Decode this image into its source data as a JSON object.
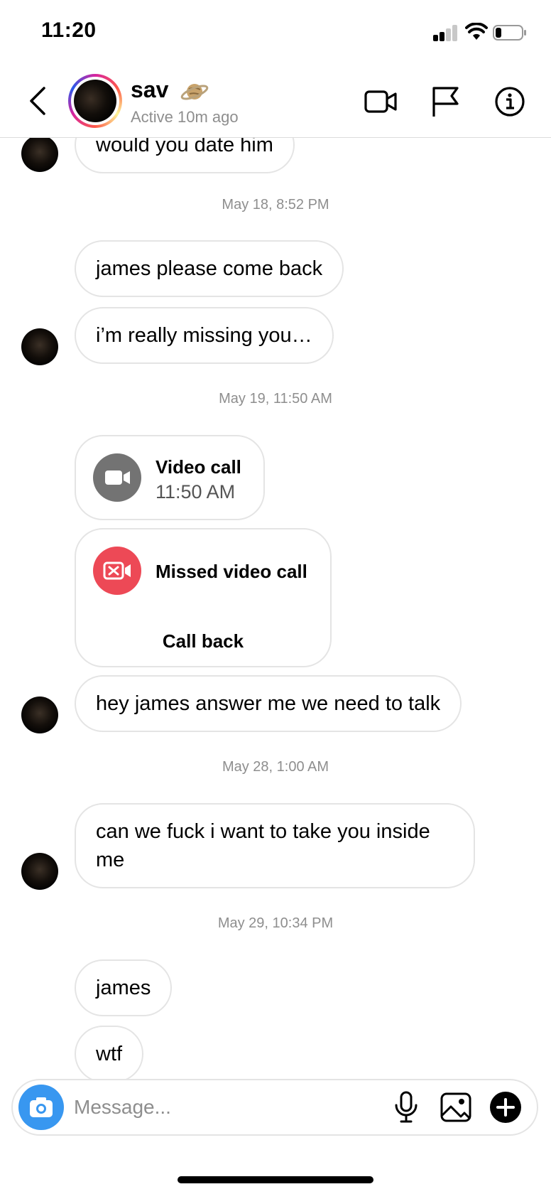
{
  "status_bar": {
    "time": "11:20",
    "signal_bars": 2,
    "battery_level": 0.2
  },
  "header": {
    "contact_name": "sav",
    "name_emoji": "planet",
    "active_status": "Active 10m ago",
    "icons": [
      "back-chevron",
      "video-camera",
      "flag",
      "info"
    ]
  },
  "thread": {
    "messages": [
      {
        "type": "text",
        "text": "would you date him"
      },
      {
        "type": "timestamp",
        "text": "May 18, 8:52 PM"
      },
      {
        "type": "text",
        "text": "james please come back"
      },
      {
        "type": "text",
        "text": "i’m really missing you…"
      },
      {
        "type": "timestamp",
        "text": "May 19, 11:50 AM"
      },
      {
        "type": "call",
        "title": "Video call",
        "subtitle": "11:50 AM"
      },
      {
        "type": "missed_call",
        "title": "Missed video call",
        "action": "Call back"
      },
      {
        "type": "text",
        "text": "hey james answer me we need to talk"
      },
      {
        "type": "timestamp",
        "text": "May 28, 1:00 AM"
      },
      {
        "type": "text",
        "text": "can we fuck i want to take you inside me"
      },
      {
        "type": "timestamp",
        "text": "May 29, 10:34 PM"
      },
      {
        "type": "text",
        "text": "james"
      },
      {
        "type": "text",
        "text": "wtf"
      }
    ]
  },
  "composer": {
    "placeholder": "Message...",
    "value": ""
  },
  "colors": {
    "accent_blue": "#3897f0",
    "missed_call_red": "#ed4956",
    "call_gray": "#737373",
    "bubble_border": "#e4e4e4",
    "secondary_text": "#8e8e8e"
  }
}
